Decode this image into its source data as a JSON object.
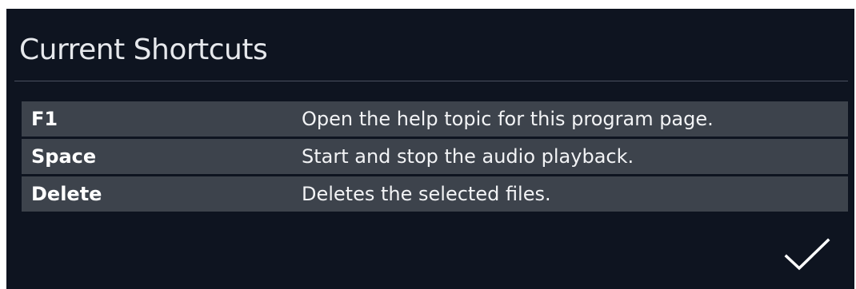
{
  "dialog": {
    "title": "Current Shortcuts"
  },
  "shortcuts": [
    {
      "key": "F1",
      "description": "Open the help topic for this program page."
    },
    {
      "key": "Space",
      "description": "Start and stop the audio playback."
    },
    {
      "key": "Delete",
      "description": "Deletes the selected files."
    }
  ],
  "confirm": {
    "icon": "checkmark-icon"
  },
  "colors": {
    "background": "#0e1420",
    "row_background": "#3d434c",
    "text": "#ffffff",
    "divider": "#4a5160"
  }
}
